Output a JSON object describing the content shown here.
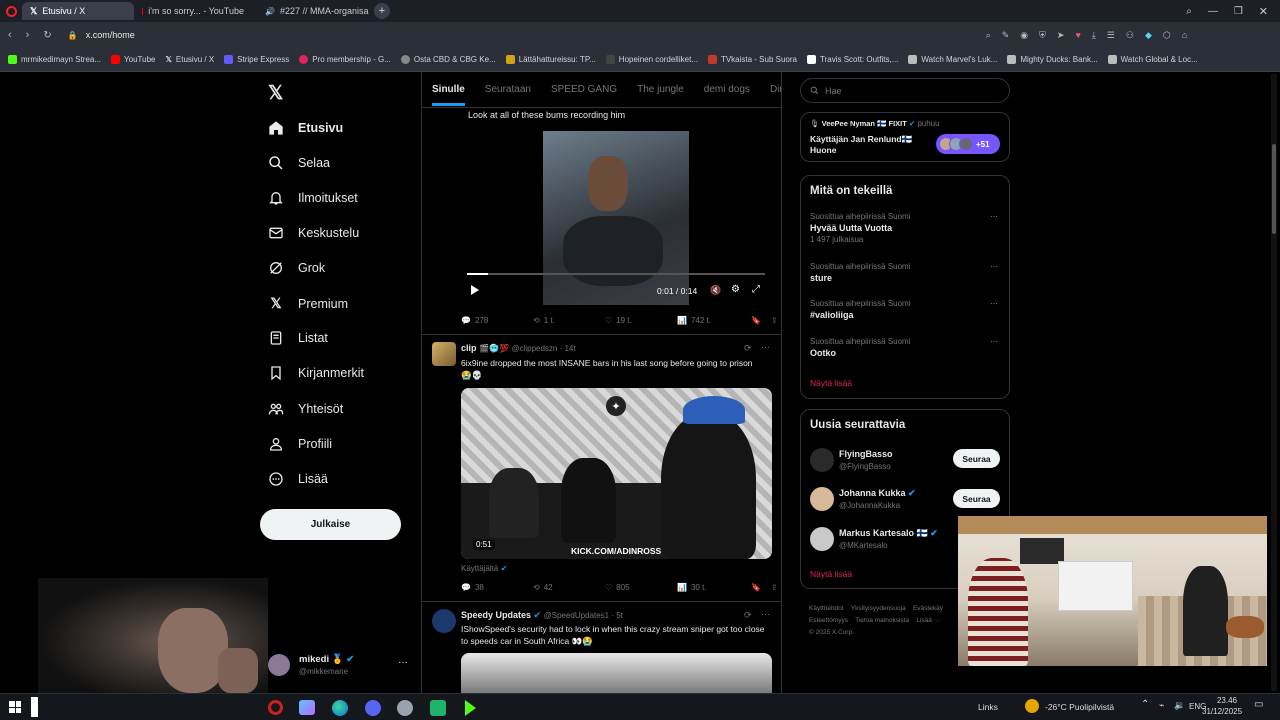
{
  "browser": {
    "tabs": [
      {
        "label": "Etusivu / X",
        "active": true
      },
      {
        "label": "i'm so sorry... - YouTube",
        "active": false
      },
      {
        "label": "#227 // MMA-organisa",
        "active": false
      }
    ],
    "url": "x.com/home",
    "bookmarks": [
      {
        "label": "mrmikedimayn Strea...",
        "color": "#53fc18"
      },
      {
        "label": "YouTube",
        "color": "#ff0000"
      },
      {
        "label": "Etusivu / X",
        "color": "#ffffff"
      },
      {
        "label": "Stripe Express",
        "color": "#635bff"
      },
      {
        "label": "Pro membership - G...",
        "color": "#e0245e"
      },
      {
        "label": "Osta CBD & CBG Ke...",
        "color": "#888888"
      },
      {
        "label": "Lättähattureissu: TP...",
        "color": "#d4a017"
      },
      {
        "label": "Hopeinen cordelliket...",
        "color": "#444444"
      },
      {
        "label": "TVkaista - Sub Suora",
        "color": "#c0392b"
      },
      {
        "label": "Travis Scott: Outfits,...",
        "color": "#ffffff"
      },
      {
        "label": "Watch Marvel's Luk...",
        "color": "#bbbbbb"
      },
      {
        "label": "Mighty Ducks: Bank...",
        "color": "#bbbbbb"
      },
      {
        "label": "Watch Global & Loc...",
        "color": "#bbbbbb"
      }
    ]
  },
  "nav": {
    "items": [
      {
        "label": "Etusivu",
        "icon": "home-icon"
      },
      {
        "label": "Selaa",
        "icon": "search-icon"
      },
      {
        "label": "Ilmoitukset",
        "icon": "bell-icon"
      },
      {
        "label": "Keskustelu",
        "icon": "mail-icon"
      },
      {
        "label": "Grok",
        "icon": "grok-icon"
      },
      {
        "label": "Premium",
        "icon": "x-logo-icon"
      },
      {
        "label": "Listat",
        "icon": "list-icon"
      },
      {
        "label": "Kirjanmerkit",
        "icon": "bookmark-icon"
      },
      {
        "label": "Yhteisöt",
        "icon": "people-icon"
      },
      {
        "label": "Profiili",
        "icon": "person-icon"
      },
      {
        "label": "Lisää",
        "icon": "more-circle-icon"
      }
    ],
    "post_button": "Julkaise",
    "user": {
      "name": "mikedi",
      "handle": "@mikkemane"
    }
  },
  "feed": {
    "tabs": [
      "Sinulle",
      "Seurataan",
      "SPEED GANG",
      "The jungle",
      "demi dogs",
      "Dima's Di"
    ],
    "post1": {
      "text": "Look at all of these bums recording him",
      "video_time": "0:01 / 0:14",
      "progress": 0.07,
      "stats": {
        "replies": "278",
        "reposts": "1 t.",
        "likes": "19 t.",
        "views": "742 t."
      }
    },
    "post2": {
      "name": "clip",
      "emoji": "🎬🥶💯",
      "handle": "@clippedszn · 14t",
      "text": "6ix9ine dropped the most INSANE bars in his last song before going to prison 😭💀",
      "video_time": "0:51",
      "watermark": "KICK.COM/ADINROSS",
      "credit": "Käyttäjältä",
      "stats": {
        "replies": "38",
        "reposts": "42",
        "likes": "805",
        "views": "30 t."
      }
    },
    "post3": {
      "name": "Speedy Updates",
      "handle": "@SpeedUpdates1 · 5t",
      "text": "IShowSpeed's security had to lock in when this crazy stream sniper got too close to speeds car in South Africa 👀😭"
    }
  },
  "right": {
    "search_placeholder": "Hae",
    "space": {
      "host": "VeePee Nyman 🇫🇮 FIXIT",
      "status": "puhuu",
      "title": "Käyttäjän Jan Renlund🇫🇮 Huone",
      "count": "+51"
    },
    "trends_title": "Mitä on tekeillä",
    "trends": [
      {
        "context": "Suosittua aihepiirissä Suomi",
        "name": "Hyvää Uutta Vuotta",
        "count": "1 497 julkaisua"
      },
      {
        "context": "Suosittua aihepiirissä Suomi",
        "name": "sture",
        "count": ""
      },
      {
        "context": "Suosittua aihepiirissä Suomi",
        "name": "#valioliiga",
        "count": ""
      },
      {
        "context": "Suosittua aihepiirissä Suomi",
        "name": "Ootko",
        "count": ""
      }
    ],
    "show_more": "Näytä lisää",
    "who_title": "Uusia seurattavia",
    "who": [
      {
        "name": "FlyingBasso",
        "handle": "@FlyingBasso",
        "verified": false
      },
      {
        "name": "Johanna Kukka",
        "handle": "@JohannaKukka",
        "verified": true
      },
      {
        "name": "Markus Kartesalo 🇫🇮",
        "handle": "@MKartesalo",
        "verified": true
      }
    ],
    "follow_label": "Seuraa",
    "show_more2": "Näytä lisää",
    "footer": [
      "Käyttöehdot",
      "Yksityisyydensuoja",
      "Evästekäy",
      "Esteettömyys",
      "Tietoa mainoksista",
      "Lisää ···",
      "© 2025 X Corp."
    ]
  },
  "taskbar": {
    "links": "Links",
    "weather": "-26°C  Puolipilvistä",
    "lang": "ENG",
    "time": "23.46",
    "date": "31/12/2025"
  }
}
